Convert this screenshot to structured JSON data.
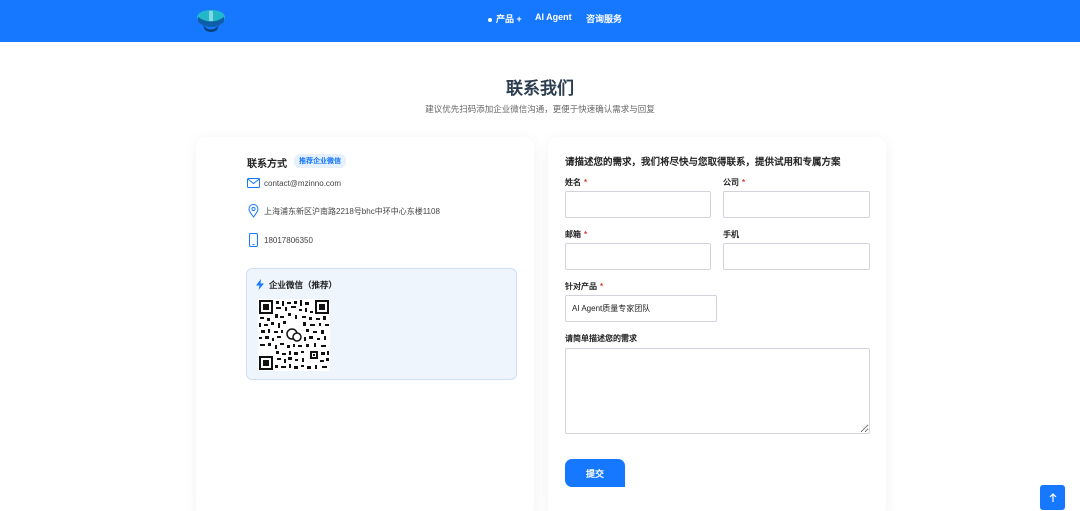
{
  "nav": {
    "products": "产品 +",
    "ai_agent": "AI Agent",
    "consulting": "咨询服务"
  },
  "page": {
    "title": "联系我们",
    "subtitle": "建议优先扫码添加企业微信沟通，更便于快速确认需求与回复"
  },
  "contact": {
    "heading": "联系方式",
    "badge": "推荐企业微信",
    "email": "contact@mzinno.com",
    "address": "上海浦东新区沪南路2218号bhc中环中心东楼1108",
    "phone": "18017806350",
    "wechat_title": "企业微信（推荐）"
  },
  "form": {
    "heading": "请描述您的需求，我们将尽快与您取得联系，提供试用和专属方案",
    "name_label": "姓名",
    "company_label": "公司",
    "email_label": "邮箱",
    "mobile_label": "手机",
    "product_label": "针对产品",
    "product_value": "AI Agent质量专家团队",
    "desc_label": "请简单描述您的需求",
    "required_mark": "*",
    "submit_label": "提交"
  },
  "colors": {
    "brand": "#1677ff",
    "required": "#e53935"
  },
  "icons": {
    "email": "mail-icon",
    "address": "location-pin-icon",
    "phone": "mobile-phone-icon",
    "wechat": "lightning-icon",
    "back_to_top": "arrow-up-icon"
  }
}
